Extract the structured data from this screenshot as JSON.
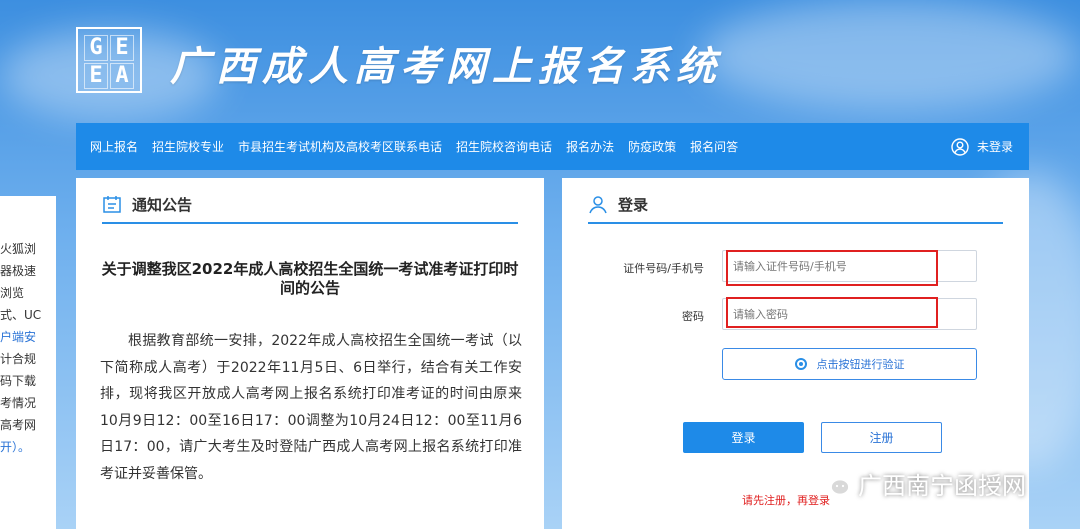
{
  "header": {
    "logo_letters": [
      "G",
      "E",
      "E",
      "A"
    ],
    "site_title": "广西成人高考网上报名系统"
  },
  "nav": {
    "items": [
      "网上报名",
      "招生院校专业",
      "市县招生考试机构及高校考区联系电话",
      "招生院校咨询电话",
      "报名办法",
      "防疫政策",
      "报名问答"
    ],
    "login_status": "未登录"
  },
  "left_strip": [
    "火狐浏",
    "器极速",
    "浏览",
    "式、UC",
    "",
    "户端安",
    "计合规",
    "",
    "码下载",
    "考情况",
    "",
    "高考网",
    "开）。"
  ],
  "notice": {
    "header": "通知公告",
    "title": "关于调整我区2022年成人高校招生全国统一考试准考证打印时间的公告",
    "body": "根据教育部统一安排，2022年成人高校招生全国统一考试（以下简称成人高考）于2022年11月5日、6日举行，结合有关工作安排，现将我区开放成人高考网上报名系统打印准考证的时间由原来10月9日12：00至16日17：00调整为10月24日12：00至11月6日17：00，请广大考生及时登陆广西成人高考网上报名系统打印准考证并妥善保管。"
  },
  "login": {
    "header": "登录",
    "id_label": "证件号码/手机号",
    "id_placeholder": "请输入证件号码/手机号",
    "password_label": "密码",
    "password_placeholder": "请输入密码",
    "verify_label": "点击按钮进行验证",
    "login_button": "登录",
    "register_button": "注册",
    "hint": "请先注册，再登录"
  },
  "watermark": "广西南宁函授网",
  "colors": {
    "primary": "#1e8ae8",
    "highlight_red": "#e02020",
    "link_blue": "#2a73d6"
  }
}
